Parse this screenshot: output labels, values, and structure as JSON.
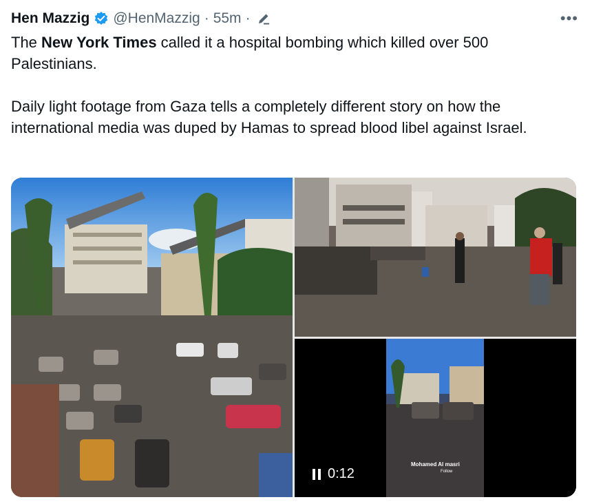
{
  "tweet": {
    "author_name": "Hen Mazzig",
    "handle": "@HenMazzig",
    "separator": "·",
    "time": "55m",
    "more_label": "•••",
    "paragraph1_prefix": "The ",
    "paragraph1_bold": "New York Times",
    "paragraph1_suffix": " called it a hospital bombing which killed over 500 Palestinians.",
    "paragraph2": "Daily light footage from Gaza tells a completely different story on how the international media was duped by Hamas to spread blood libel against Israel."
  },
  "video": {
    "time": "0:12",
    "overlay_name": "Mohamed Al masri",
    "overlay_follow": "Follow"
  },
  "icons": {
    "verified": "verified-badge-icon",
    "edit": "edit-pencil-icon",
    "more": "more-icon",
    "pause": "pause-icon"
  },
  "colors": {
    "text": "#0f1419",
    "secondary": "#536471",
    "verified": "#1d9bf0"
  }
}
